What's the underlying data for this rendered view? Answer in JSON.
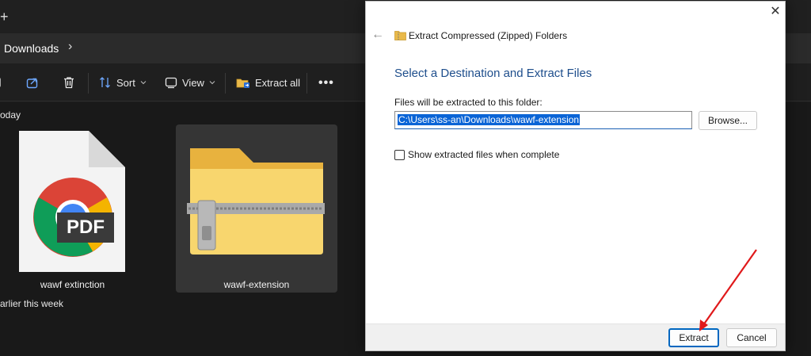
{
  "explorer": {
    "new_tab_glyph": "+",
    "address_path": "Downloads",
    "address_chevron": "›",
    "toolbar": {
      "sort_label": "Sort",
      "view_label": "View",
      "extract_all_label": "Extract all",
      "more_label": "•••"
    },
    "groups": {
      "today_label": "oday",
      "earlier_label": "arlier this week"
    },
    "files": [
      {
        "name": "wawf extinction",
        "icon": "pdf-file-icon",
        "badge": "PDF"
      },
      {
        "name": "wawf-extension",
        "icon": "zipped-folder-icon"
      }
    ]
  },
  "dialog": {
    "close_glyph": "✕",
    "back_glyph": "←",
    "title": "Extract Compressed (Zipped) Folders",
    "heading": "Select a Destination and Extract Files",
    "path_label": "Files will be extracted to this folder:",
    "path_value": "C:\\Users\\ss-an\\Downloads\\wawf-extension",
    "browse_label": "Browse...",
    "show_files_label": "Show extracted files when complete",
    "show_files_checked": false,
    "extract_label": "Extract",
    "cancel_label": "Cancel"
  },
  "colors": {
    "heading_blue": "#1e4e8c",
    "selection_blue": "#0a64d6",
    "annotation_arrow": "#e0191b"
  }
}
